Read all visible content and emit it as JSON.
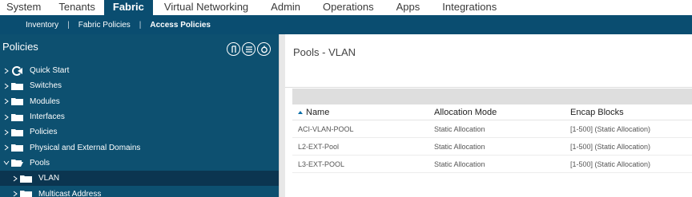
{
  "topnav": {
    "tabs": [
      "System",
      "Tenants",
      "Fabric",
      "Virtual Networking",
      "Admin",
      "Operations",
      "Apps",
      "Integrations"
    ],
    "active": "Fabric"
  },
  "subnav": {
    "items": [
      "Inventory",
      "Fabric Policies",
      "Access Policies"
    ],
    "active": "Access Policies"
  },
  "sidebar": {
    "title": "Policies",
    "items": [
      {
        "label": "Quick Start"
      },
      {
        "label": "Switches"
      },
      {
        "label": "Modules"
      },
      {
        "label": "Interfaces"
      },
      {
        "label": "Policies"
      },
      {
        "label": "Physical and External Domains"
      },
      {
        "label": "Pools"
      },
      {
        "label": "VLAN"
      },
      {
        "label": "Multicast Address"
      }
    ]
  },
  "main": {
    "title": "Pools - VLAN",
    "table": {
      "headers": [
        "Name",
        "Allocation Mode",
        "Encap Blocks"
      ],
      "rows": [
        [
          "ACI-VLAN-POOL",
          "Static Allocation",
          "[1-500] (Static Allocation)"
        ],
        [
          "L2-EXT-Pool",
          "Static Allocation",
          "[1-500] (Static Allocation)"
        ],
        [
          "L3-EXT-POOL",
          "Static Allocation",
          "[1-500] (Static Allocation)"
        ]
      ]
    }
  },
  "colors": {
    "nav_active": "#0a4d70",
    "sidebar_bg": "#0d5070",
    "sidebar_selected": "#0b3550",
    "sort_arrow": "#0a6ea8"
  }
}
